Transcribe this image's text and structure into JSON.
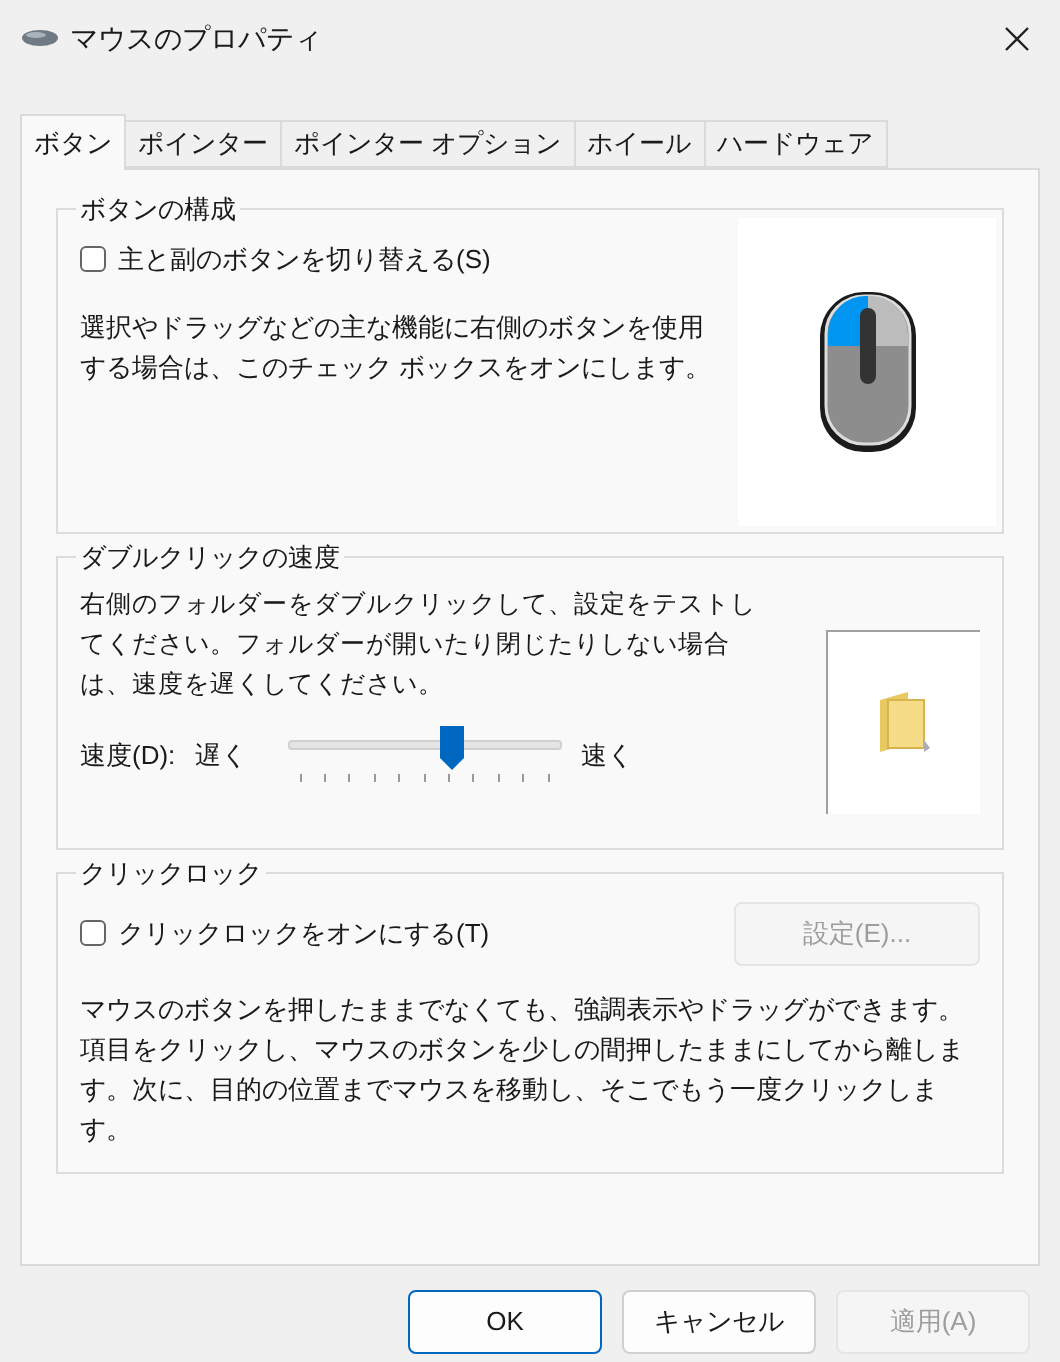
{
  "window": {
    "title": "マウスのプロパティ"
  },
  "tabs": [
    {
      "label": "ボタン",
      "selected": true
    },
    {
      "label": "ポインター",
      "selected": false
    },
    {
      "label": "ポインター オプション",
      "selected": false
    },
    {
      "label": "ホイール",
      "selected": false
    },
    {
      "label": "ハードウェア",
      "selected": false
    }
  ],
  "button_config": {
    "title": "ボタンの構成",
    "checkbox": {
      "label": "主と副のボタンを切り替える(S)",
      "checked": false
    },
    "description": "選択やドラッグなどの主な機能に右側のボタンを使用する場合は、このチェック ボックスをオンにします。"
  },
  "double_click": {
    "title": "ダブルクリックの速度",
    "description": "右側のフォルダーをダブルクリックして、設定をテストしてください。フォルダーが開いたり閉じたりしない場合は、速度を遅くしてください。",
    "speed_label": "速度(D):",
    "slow_label": "遅く",
    "fast_label": "速く",
    "slider": {
      "level": 0.6
    }
  },
  "click_lock": {
    "title": "クリックロック",
    "checkbox": {
      "label": "クリックロックをオンにする(T)",
      "checked": false
    },
    "settings_button": {
      "label": "設定(E)...",
      "disabled": true
    },
    "description": "マウスのボタンを押したままでなくても、強調表示やドラッグができます。項目をクリックし、マウスのボタンを少しの間押したままにしてから離します。次に、目的の位置までマウスを移動し、そこでもう一度クリックします。"
  },
  "buttons": [
    {
      "label": "OK",
      "default": true,
      "disabled": false
    },
    {
      "label": "キャンセル",
      "default": false,
      "disabled": false
    },
    {
      "label": "適用(A)",
      "default": false,
      "disabled": true
    }
  ]
}
